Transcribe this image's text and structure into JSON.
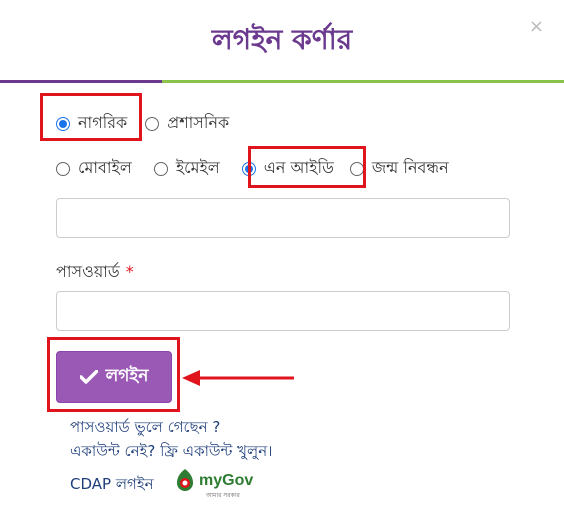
{
  "dialog": {
    "title": "লগইন কর্ণার",
    "close": "×"
  },
  "account_type": {
    "options": [
      {
        "label": "নাগরিক",
        "selected": true
      },
      {
        "label": "প্রশাসনিক",
        "selected": false
      }
    ]
  },
  "login_method": {
    "options": [
      {
        "label": "মোবাইল",
        "selected": false
      },
      {
        "label": "ইমেইল",
        "selected": false
      },
      {
        "label": "এন আইডি",
        "selected": true
      },
      {
        "label": "জন্ম নিবন্ধন",
        "selected": false
      }
    ]
  },
  "password": {
    "label": "পাসওয়ার্ড",
    "required_mark": "*"
  },
  "login_button": {
    "label": "লগইন",
    "icon": "check-icon"
  },
  "links": {
    "forgot": "পাসওয়ার্ড ভুলে গেছেন ?",
    "register": "একাউন্ট নেই? ফ্রি একাউন্ট খুলুন।",
    "cdap": "CDAP লগইন",
    "mygov": "myGov",
    "mygov_tagline": "আমার সরকার"
  },
  "colors": {
    "title": "#6b3a8f",
    "divider_left": "#6b3a8f",
    "divider_right": "#8bc34a",
    "button": "#9b59b6",
    "highlight": "#e0141d",
    "radio_selected": "#1a73e8",
    "link": "#1f3e7a"
  }
}
